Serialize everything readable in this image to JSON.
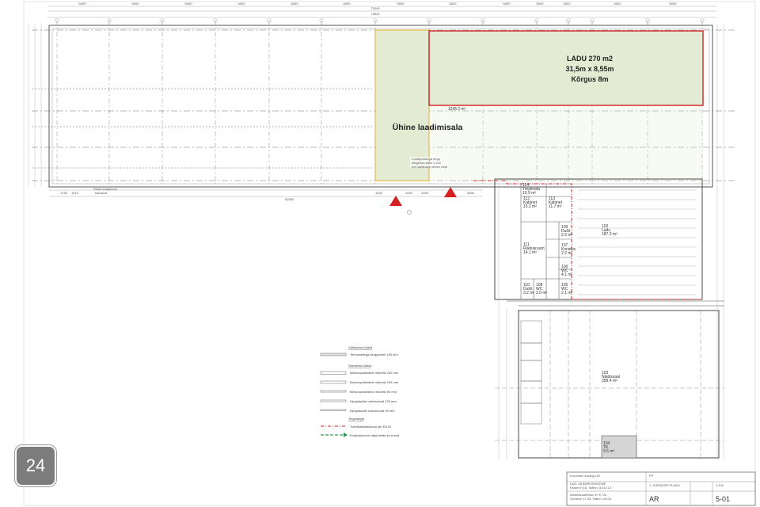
{
  "colors": {
    "shared_area_fill": "#e3ecd3",
    "shared_area_border": "#e1b949",
    "warehouse_fill": "#e3ecd3",
    "warehouse_border": "#cc2222",
    "exit_marker": "#d42020",
    "evac_route": "#2f9a55"
  },
  "warehouse": {
    "line1": "LADU 270 m2",
    "line2": "31,5m x 8,55m",
    "line3": "Kõrgus 8m"
  },
  "shared_area": {
    "label": "Ühine laadimisala",
    "room_no": "101",
    "room_area": "1245.2 m²"
  },
  "top_dims": {
    "total1": "73040",
    "total2": "73520",
    "spans": [
      "6000",
      "6000",
      "6000",
      "6000",
      "6000",
      "6000",
      "6000",
      "6000",
      "6000",
      "6000",
      "6000",
      "6000",
      "6000"
    ]
  },
  "bottom_dims": [
    "1750",
    "1010",
    "52500",
    "1000",
    "1000",
    "1000",
    "2650"
  ],
  "left_note": [
    "Rekki maapinnal",
    "katuseta"
  ],
  "rooms": [
    {
      "no": "114",
      "name": "Trepikoda",
      "area": "10.9 m²"
    },
    {
      "no": "112",
      "name": "Kabinet",
      "area": "15.2 m²"
    },
    {
      "no": "113",
      "name": "Kabinet",
      "area": "11.7 m²"
    },
    {
      "no": "109",
      "name": "Dušš",
      "area": "2.2 m²"
    },
    {
      "no": "111",
      "name": "Riietusruum",
      "area": "14.1 m²"
    },
    {
      "no": "107",
      "name": "Koristus",
      "area": "2.2 m²"
    },
    {
      "no": "106",
      "name": "WC",
      "area": "4.1 m²"
    },
    {
      "no": "110",
      "name": "Dušš",
      "area": "3.2 m²"
    },
    {
      "no": "108",
      "name": "WC",
      "area": "2.0 m²"
    },
    {
      "no": "105",
      "name": "WC",
      "area": "2.1 m²"
    },
    {
      "no": "102",
      "name": "Ladu",
      "area": "187.2 m²"
    },
    {
      "no": "103",
      "name": "Näidissaal",
      "area": "358.4 m²"
    },
    {
      "no": "104",
      "name": "TK",
      "area": "9.5 m²"
    }
  ],
  "legend": {
    "title1": "Välisseina tüübid",
    "items1": [
      "Termokattega kergpaneel 180 mm"
    ],
    "title2": "Siseseina tüübid",
    "items2": [
      "Betoonplokkidest müüritis 240 mm",
      "Betoonplokkidest müüritis 190 mm",
      "Betoonplokkidest müüritis 90 mm",
      "Kipsplaadist vaheseinad 120 mm",
      "Kipsplaadist vaheseinad 95 mm"
    ],
    "title3": "Tingmärgid",
    "items3": [
      "Tuletõkkesektsioon piir EI120",
      "Evakuatsiooni väljumistee ja suund"
    ]
  },
  "stamp": {
    "company": "Kruuman Holding OÜ",
    "project": "LAO- JA BÜROOHOONE",
    "address": "Estoni tn 18, Tallinn 11014 L3",
    "drawing": "1. KORRUSE PLAAN",
    "stage": "PP",
    "scale": "1:100",
    "section": "AR",
    "sheet": "5-01",
    "architect": "Arhitektuuribüroo K+K OÜ",
    "arch_address": "Gonsiori 17-34, Tallinn 10124"
  },
  "page_badge": "24"
}
